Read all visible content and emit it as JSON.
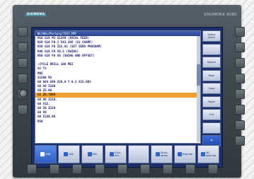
{
  "panel": {
    "brand": "SIEMENS",
    "product": "SINUMERIK 808D"
  },
  "editor": {
    "title": "NC/Wks/Partprg/TEST.MPF",
    "lines": [
      "N10 G18 M3 S1200 (AXIAL FEED)",
      "N20 G18 F0.1 X43.266 (G1 CHAMF)",
      "N30 G18 F0 Z15.81 (SET ZERO PROGRAM)",
      "N40 G18 F0 X0.5 (SWING)",
      "N50 G18 F0 X0 (SWING AND OFFSET)",
      "",
      ";CYCLE DRILL 100 MEI",
      "G1 T3",
      "M06",
      "S1500 M3",
      "G0 G64 G90 X20.0 Y 0.5 X15.003",
      "G0 X0 Z100",
      "G0 Z5.00",
      "G1 Z0.7000",
      "G0 X0 Z150.",
      "G0 X15.",
      "G0 Z0 Z150",
      "G0 X0",
      "G0 Z150.00",
      "M30"
    ],
    "highlight_index": 13
  },
  "vertical_softkeys": [
    "Select\nblock",
    "",
    "Search",
    "Mark",
    "Copy",
    "Paste",
    "Cut",
    ""
  ],
  "vertical_arrow_label": "»",
  "horizontal_softkeys": [
    {
      "label": "Edit",
      "active": true
    },
    {
      "label": "Drill",
      "active": false
    },
    {
      "label": "Mill",
      "active": false
    },
    {
      "label": "Cont.\nmill.",
      "active": false
    },
    {
      "label": "",
      "active": false
    },
    {
      "label": "Simu-\nlation",
      "active": false
    },
    {
      "label": "Execute",
      "active": false
    },
    {
      "label": "NC\nexecute",
      "active": false
    }
  ]
}
